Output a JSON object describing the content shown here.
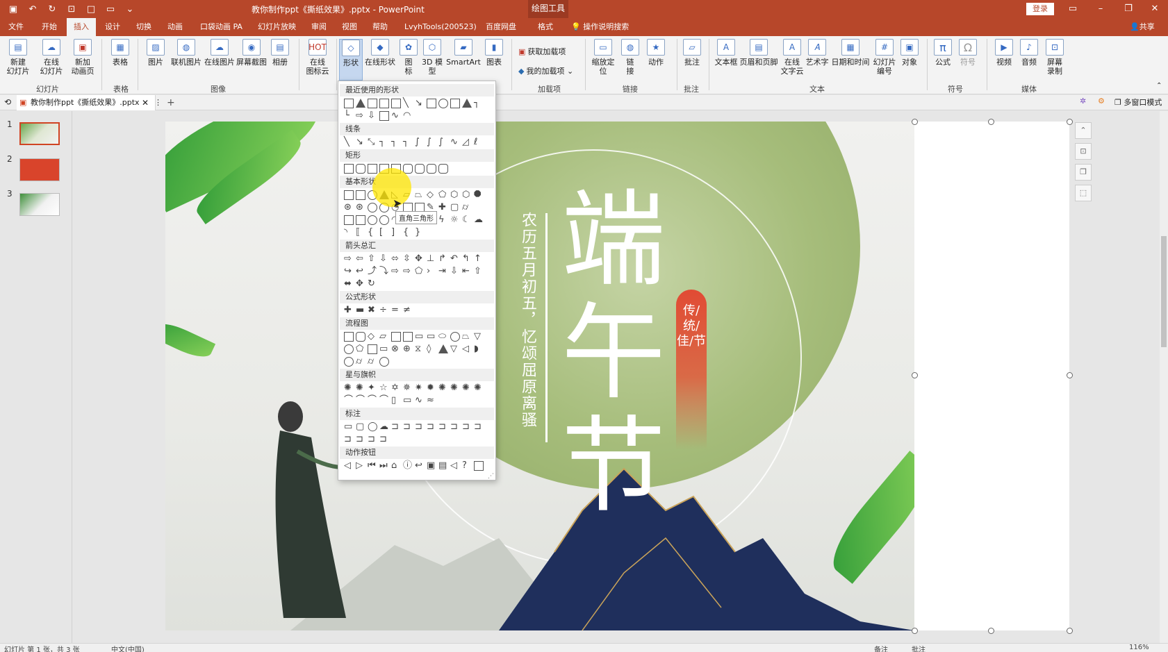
{
  "window": {
    "doc_title": "教你制作ppt《撕纸效果》.pptx  -  PowerPoint",
    "context_tab": "绘图工具",
    "login": "登录"
  },
  "tabs": [
    "文件",
    "开始",
    "插入",
    "设计",
    "切换",
    "动画",
    "口袋动画 PA",
    "幻灯片放映",
    "审阅",
    "视图",
    "帮助",
    "LvyhTools(200523)",
    "百度网盘",
    "格式"
  ],
  "active_tab": "插入",
  "tell_me": "操作说明搜索",
  "share": "共享",
  "ribbon": {
    "buttons": {
      "new_slide": "新建\n幻灯片",
      "online_slide": "在线\n幻灯片",
      "new_anim_page": "新加\n动画页",
      "table": "表格",
      "picture": "图片",
      "online_picture_linked": "联机图片",
      "online_picture": "在线图片",
      "screenshot": "屏幕截图",
      "album": "相册",
      "online_icons": "在线\n图标云",
      "shapes": "形状",
      "online_shapes": "在线形状",
      "icons": "图\n标",
      "3d_model": "3D 模\n型",
      "smartart": "SmartArt",
      "chart": "图表",
      "get_addins": "获取加载项",
      "my_addins": "我的加载项",
      "zoom": "缩放定\n位",
      "link": "链\n接",
      "action": "动作",
      "comment": "批注",
      "textbox": "文本框",
      "header_footer": "页眉和页脚",
      "online_text_cloud": "在线\n文字云",
      "wordart": "艺术字",
      "date_time": "日期和时间",
      "slide_number": "幻灯片\n编号",
      "object": "对象",
      "equation": "公式",
      "symbol": "符号",
      "video": "视频",
      "audio": "音频",
      "screen_recording": "屏幕\n录制"
    },
    "groups": {
      "slides": "幻灯片",
      "tables": "表格",
      "images": "图像",
      "addins": "加载项",
      "links": "链接",
      "comments": "批注",
      "text": "文本",
      "symbols": "符号",
      "media": "媒体"
    }
  },
  "doc_tab": "教你制作ppt《撕纸效果》.pptx",
  "multi_window": "多窗口模式",
  "thumbnails": [
    "1",
    "2",
    "3"
  ],
  "shapes_gallery": {
    "categories": [
      "最近使用的形状",
      "线条",
      "矩形",
      "基本形状",
      "箭头总汇",
      "公式形状",
      "流程图",
      "星与旗帜",
      "标注",
      "动作按钮"
    ],
    "tooltip": "直角三角形"
  },
  "slide": {
    "vertical_text": "农历五月初五，忆颂屈原离骚",
    "big_title": "端午节",
    "pill_text": "传/统/佳/节"
  },
  "status": {
    "slide_count": "幻灯片 第 1 张，共 3 张",
    "language": "中文(中国)",
    "notes": "备注",
    "comments": "批注",
    "zoom": "116%"
  },
  "colors": {
    "accent": "#b7472a",
    "ribbon_bg": "#f3f3f3",
    "circle_green": "#a6bd7b",
    "pill_red": "#e14b34"
  }
}
